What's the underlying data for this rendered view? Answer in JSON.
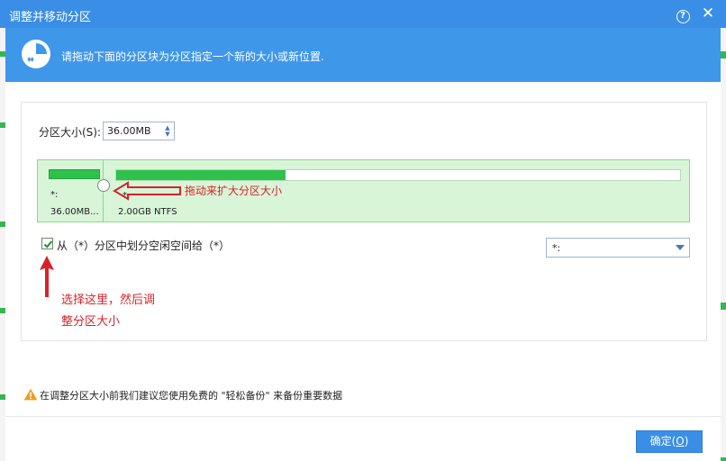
{
  "window": {
    "title": "调整并移动分区",
    "help_label": "?",
    "close_label": "✕"
  },
  "banner": {
    "text": "请拖动下面的分区块为分区指定一个新的大小或新位置."
  },
  "partition_size": {
    "label": "分区大小(S):",
    "value": "36.00MB"
  },
  "disk_map": {
    "partition_a": {
      "label": "*:",
      "size": "36.00MB...",
      "used_fraction": 1.0
    },
    "partition_b": {
      "label": "*:",
      "size": "2.00GB NTFS",
      "used_fraction": 0.3
    }
  },
  "annotations": {
    "drag_hint": "拖动来扩大分区大小",
    "select_hint_line1": "选择这里，然后调",
    "select_hint_line2": "整分区大小"
  },
  "allocate": {
    "checked": true,
    "label": "从（*）分区中划分空闲空间给（*）",
    "select_value": "*:"
  },
  "warning": {
    "text": "在调整分区大小前我们建议您使用免费的 \"轻松备份\" 来备份重要数据"
  },
  "footer": {
    "ok_label": "确定(",
    "ok_hotkey": "O",
    "ok_suffix": ")"
  },
  "colors": {
    "titlebar": "#3a8ee6",
    "banner": "#3f97ea",
    "partition_fill": "#2ec14b",
    "partition_bg": "#d8f5d8",
    "annotation": "#d8222a"
  }
}
